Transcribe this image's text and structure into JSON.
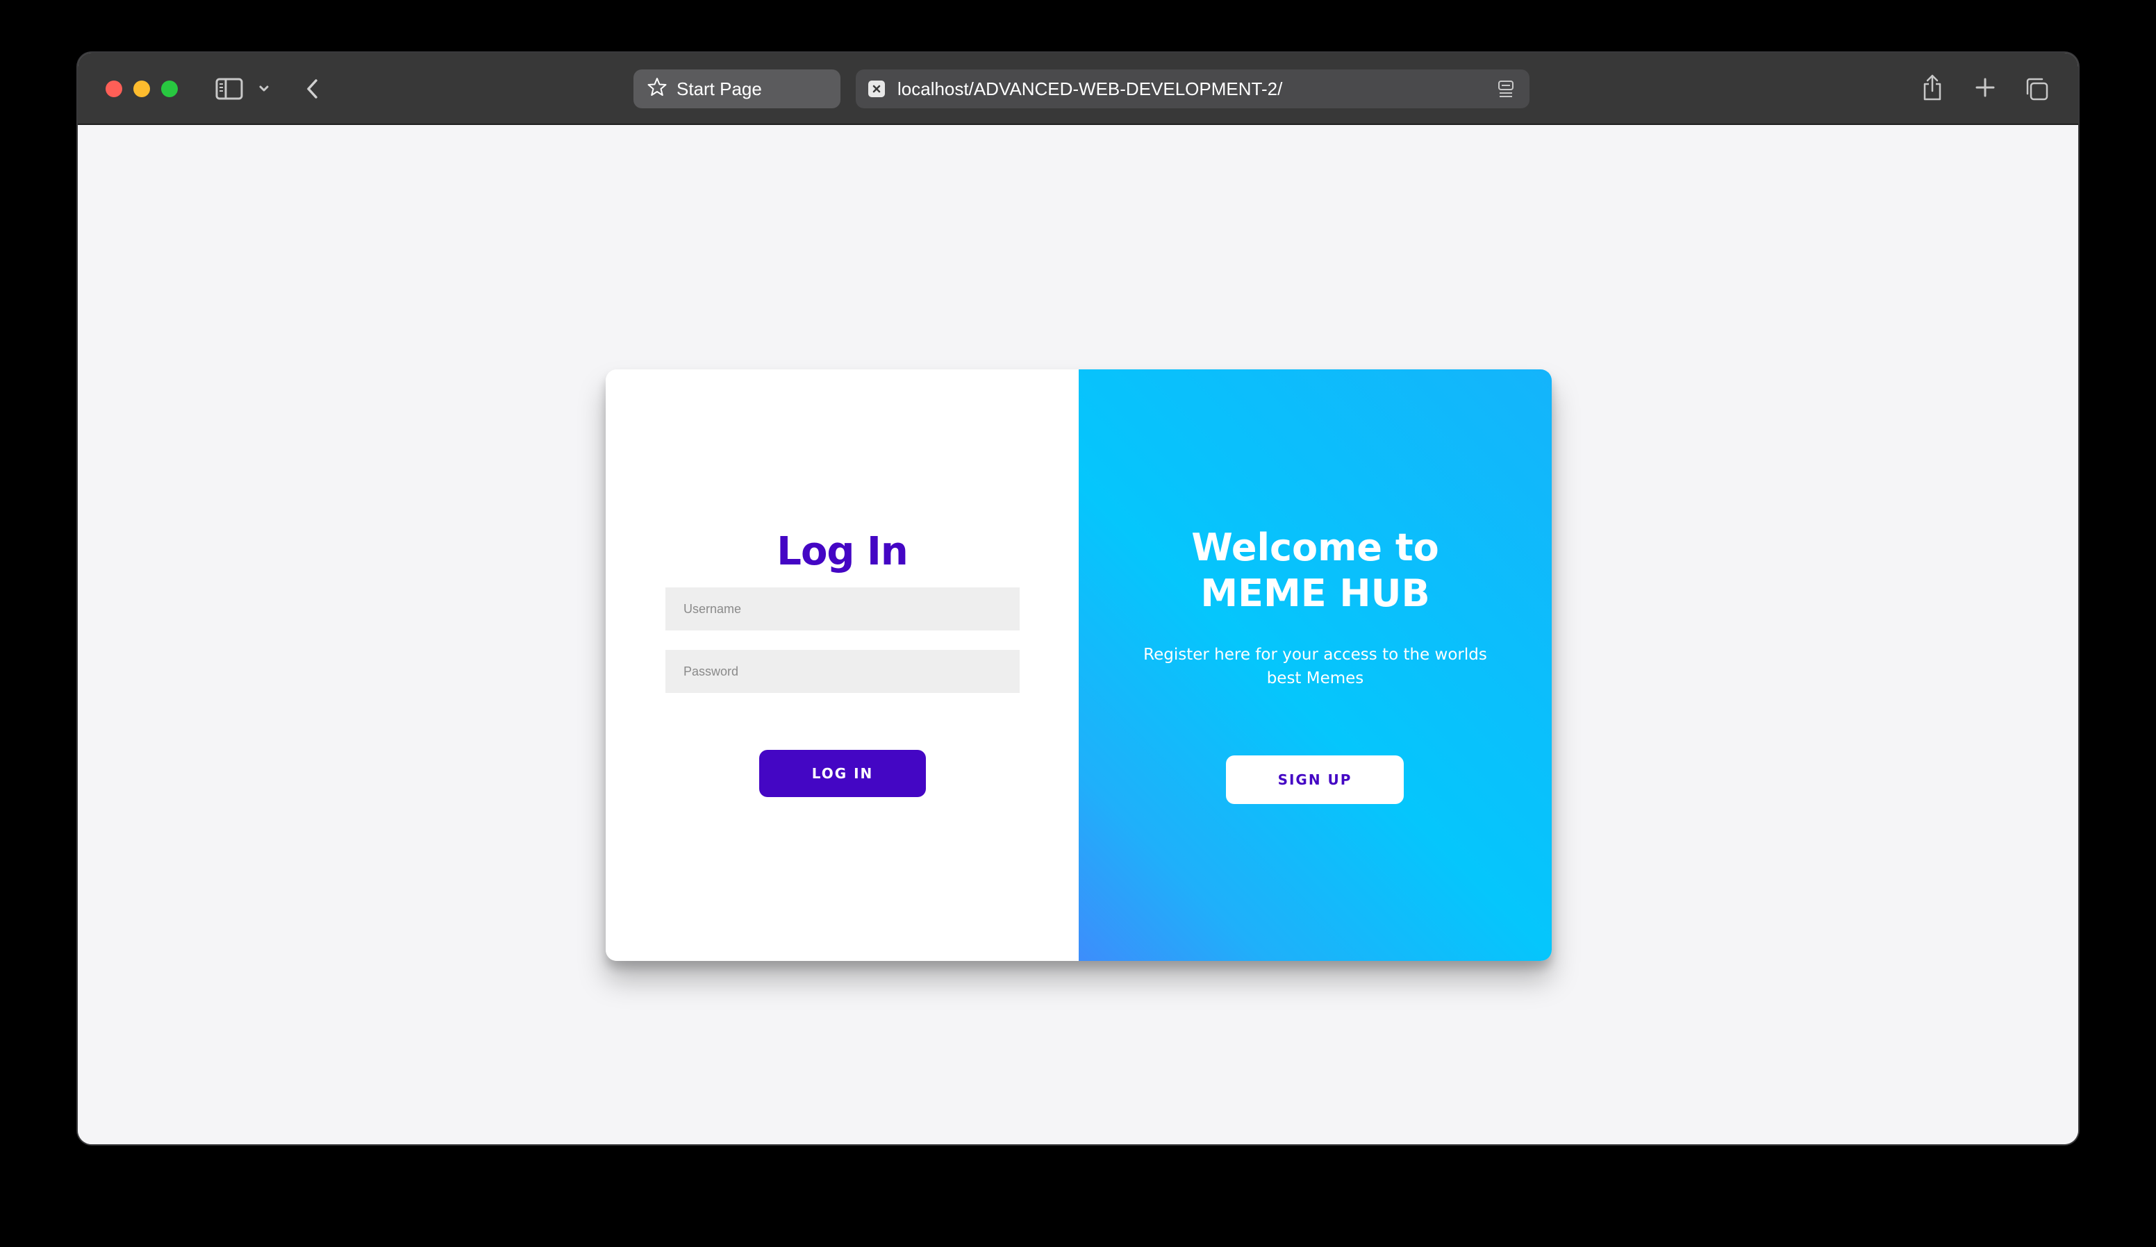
{
  "browser": {
    "tabs": [
      {
        "label": "Start Page",
        "icon": "star-icon"
      },
      {
        "label": "localhost/ADVANCED-WEB-DEVELOPMENT-2/",
        "icon": "favicon-x-icon"
      }
    ],
    "toolbar_icons": [
      "sidebar-icon",
      "chevron-down-icon",
      "back-arrow-icon",
      "reader-icon",
      "share-icon",
      "plus-icon",
      "tabs-overview-icon"
    ]
  },
  "login": {
    "title": "Log In",
    "username_placeholder": "Username",
    "password_placeholder": "Password",
    "button_label": "LOG IN"
  },
  "welcome": {
    "title_line1": "Welcome to",
    "title_line2": "MEME HUB",
    "subtitle_line1": "Register here for your access to the worlds",
    "subtitle_line2": "best Memes",
    "button_label": "SIGN UP"
  },
  "colors": {
    "brand_purple": "#4406c4",
    "panel_blue": "#05c6fc",
    "panel_blue_corner": "#3d8dfb",
    "page_background": "#f5f5f7",
    "toolbar_background": "#383838"
  }
}
